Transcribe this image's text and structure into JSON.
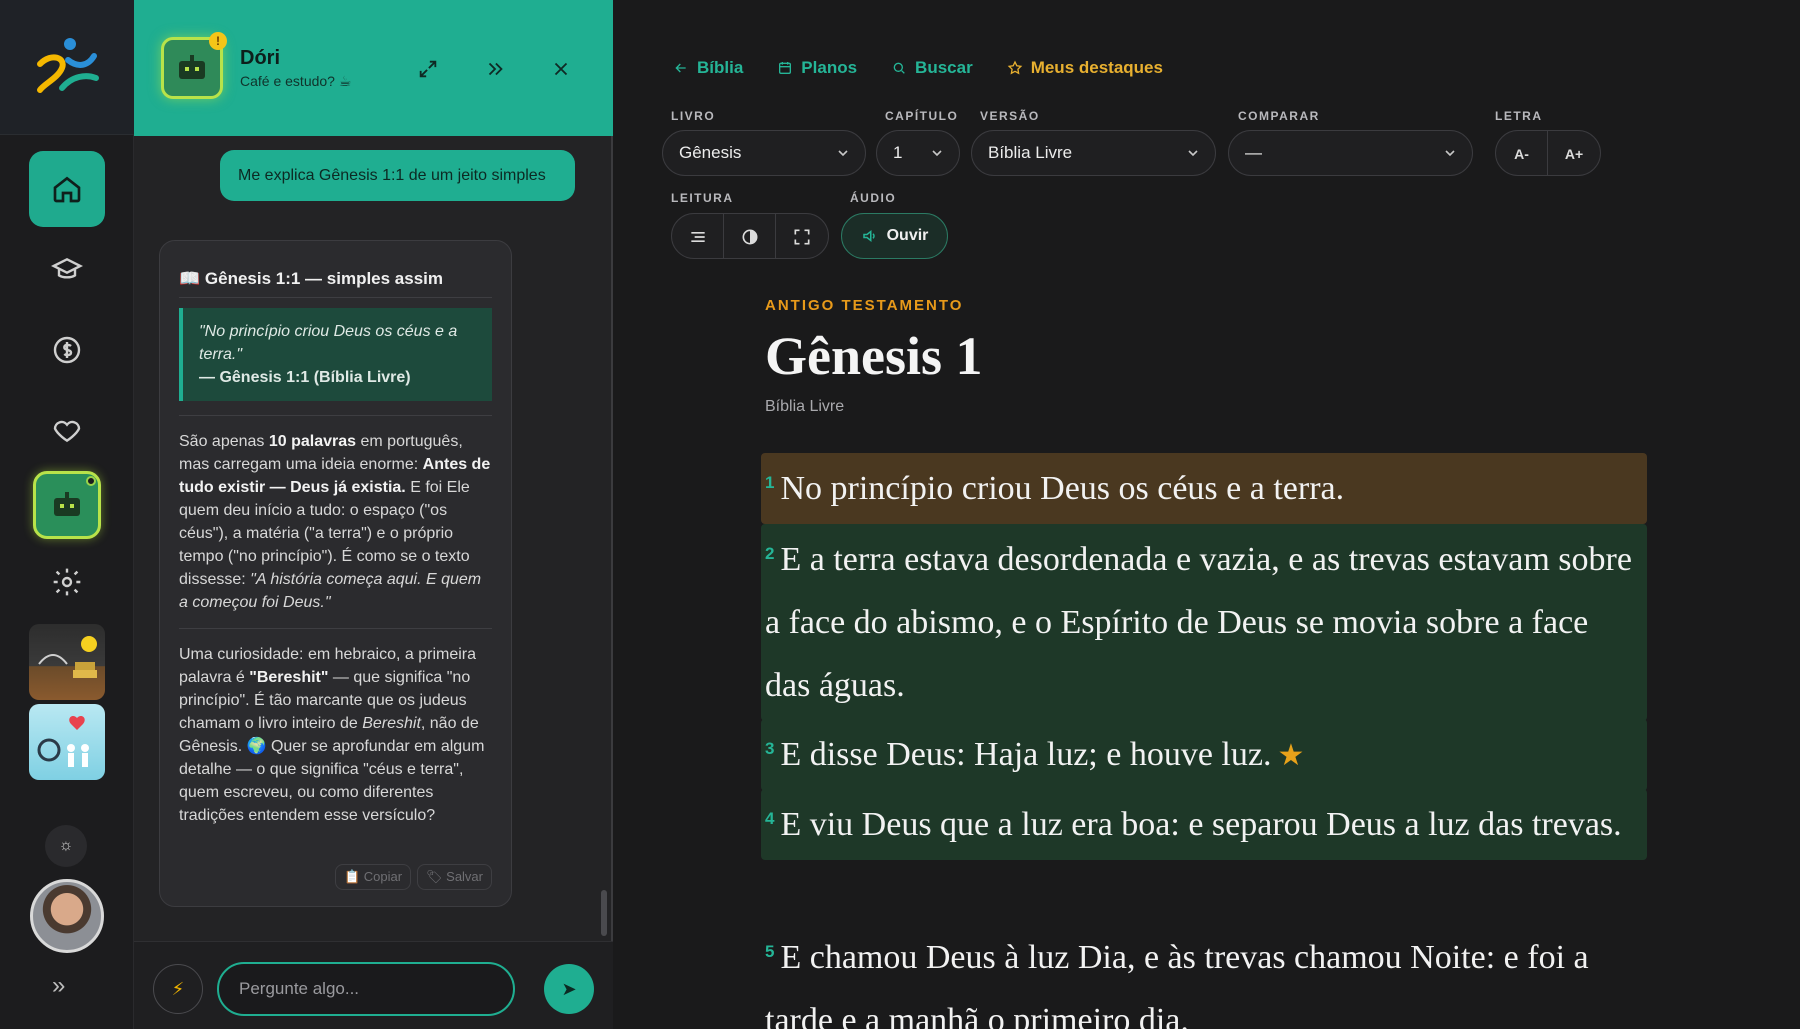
{
  "chat": {
    "bot_name": "Dóri",
    "bot_status": "Café e estudo? ☕",
    "bot_badge": "!",
    "user_message": "Me explica Gênesis 1:1 de um jeito simples",
    "card_title": "📖 Gênesis 1:1 — simples assim",
    "quote_text": "\"No princípio criou Deus os céus e a terra.\"",
    "quote_ref": "— Gênesis 1:1 (Bíblia Livre)",
    "p1": {
      "a": "São apenas ",
      "b1": "10 palavras",
      "c": " em português, mas carregam uma ideia enorme: ",
      "b2": "Antes de tudo existir — Deus já existia.",
      "d": " E foi Ele quem deu início a tudo: o espaço (\"os céus\"), a matéria (\"a terra\") e o próprio tempo (\"no princípio\"). É como se o texto dissesse: ",
      "i": "\"A história começa aqui. E quem a começou foi Deus.\""
    },
    "p2": {
      "a": "Uma curiosidade: em hebraico, a primeira palavra é ",
      "b": "\"Bereshit\"",
      "c": " — que significa \"no princípio\". É tão marcante que os judeus chamam o livro inteiro de ",
      "i": "Bereshit",
      "d": ", não de Gênesis. 🌍 Quer se aprofundar em algum detalhe — o que significa \"céus e terra\", quem escreveu, ou como diferentes tradições entendem esse versículo?"
    },
    "copy_label": "📋 Copiar",
    "save_label": "🏷 Salvar",
    "input_placeholder": "Pergunte algo...",
    "quick_icon": "⚡",
    "send_icon": "➤"
  },
  "bible": {
    "nav": [
      {
        "label": "Bíblia",
        "icon": "arrow-left-icon"
      },
      {
        "label": "Planos",
        "icon": "calendar-icon"
      },
      {
        "label": "Buscar",
        "icon": "search-icon"
      },
      {
        "label": "Meus destaques",
        "icon": "star-icon"
      }
    ],
    "labels": {
      "book": "LIVRO",
      "chapter": "CAPÍTULO",
      "version": "VERSÃO",
      "compare": "COMPARAR",
      "font": "LETRA",
      "reading": "LEITURA",
      "audio": "ÁUDIO"
    },
    "book_value": "Gênesis",
    "chapter_value": "1",
    "version_value": "Bíblia Livre",
    "compare_value": "—",
    "font_decrease": "A-",
    "font_increase": "A+",
    "listen_label": "Ouvir",
    "testament": "ANTIGO TESTAMENTO",
    "title": "Gênesis 1",
    "version_subtitle": "Bíblia Livre",
    "verses": [
      {
        "num": "1",
        "text": "No princípio criou Deus os céus e a terra.",
        "highlight": "#4a3820"
      },
      {
        "num": "2",
        "text": "E a terra estava desordenada e vazia, e as trevas estavam sobre a face do abismo, e o Espírito de Deus se movia sobre a face das águas.",
        "highlight": "#1e3828"
      },
      {
        "num": "3",
        "text": "E disse Deus: Haja luz; e houve luz.",
        "highlight": "#1e3828",
        "starred": "★"
      },
      {
        "num": "4",
        "text": "E viu Deus que a luz era boa: e separou Deus a luz das trevas.",
        "highlight": "#1e3828"
      },
      {
        "num": "5",
        "text": "E chamou Deus à luz Dia, e às trevas chamou Noite: e foi a tarde e a manhã o primeiro dia.",
        "highlight": ""
      }
    ]
  },
  "colors": {
    "accent": "#1fae91",
    "highlight_star": "#e8b030",
    "testament": "#e89a1a"
  }
}
